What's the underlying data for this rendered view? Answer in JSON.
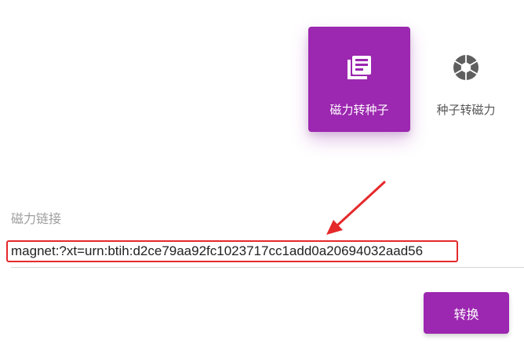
{
  "tabs": [
    {
      "label": "磁力转种子",
      "icon": "library-books-icon",
      "active": true
    },
    {
      "label": "种子转磁力",
      "icon": "camera-shutter-icon",
      "active": false
    }
  ],
  "field": {
    "label": "磁力链接",
    "value": "magnet:?xt=urn:btih:d2ce79aa92fc1023717cc1add0a20694032aad56"
  },
  "convert_button": {
    "label": "转换"
  },
  "colors": {
    "accent": "#9c27b0",
    "annotation": "#e5292b",
    "label_gray": "#9e9e9e"
  }
}
